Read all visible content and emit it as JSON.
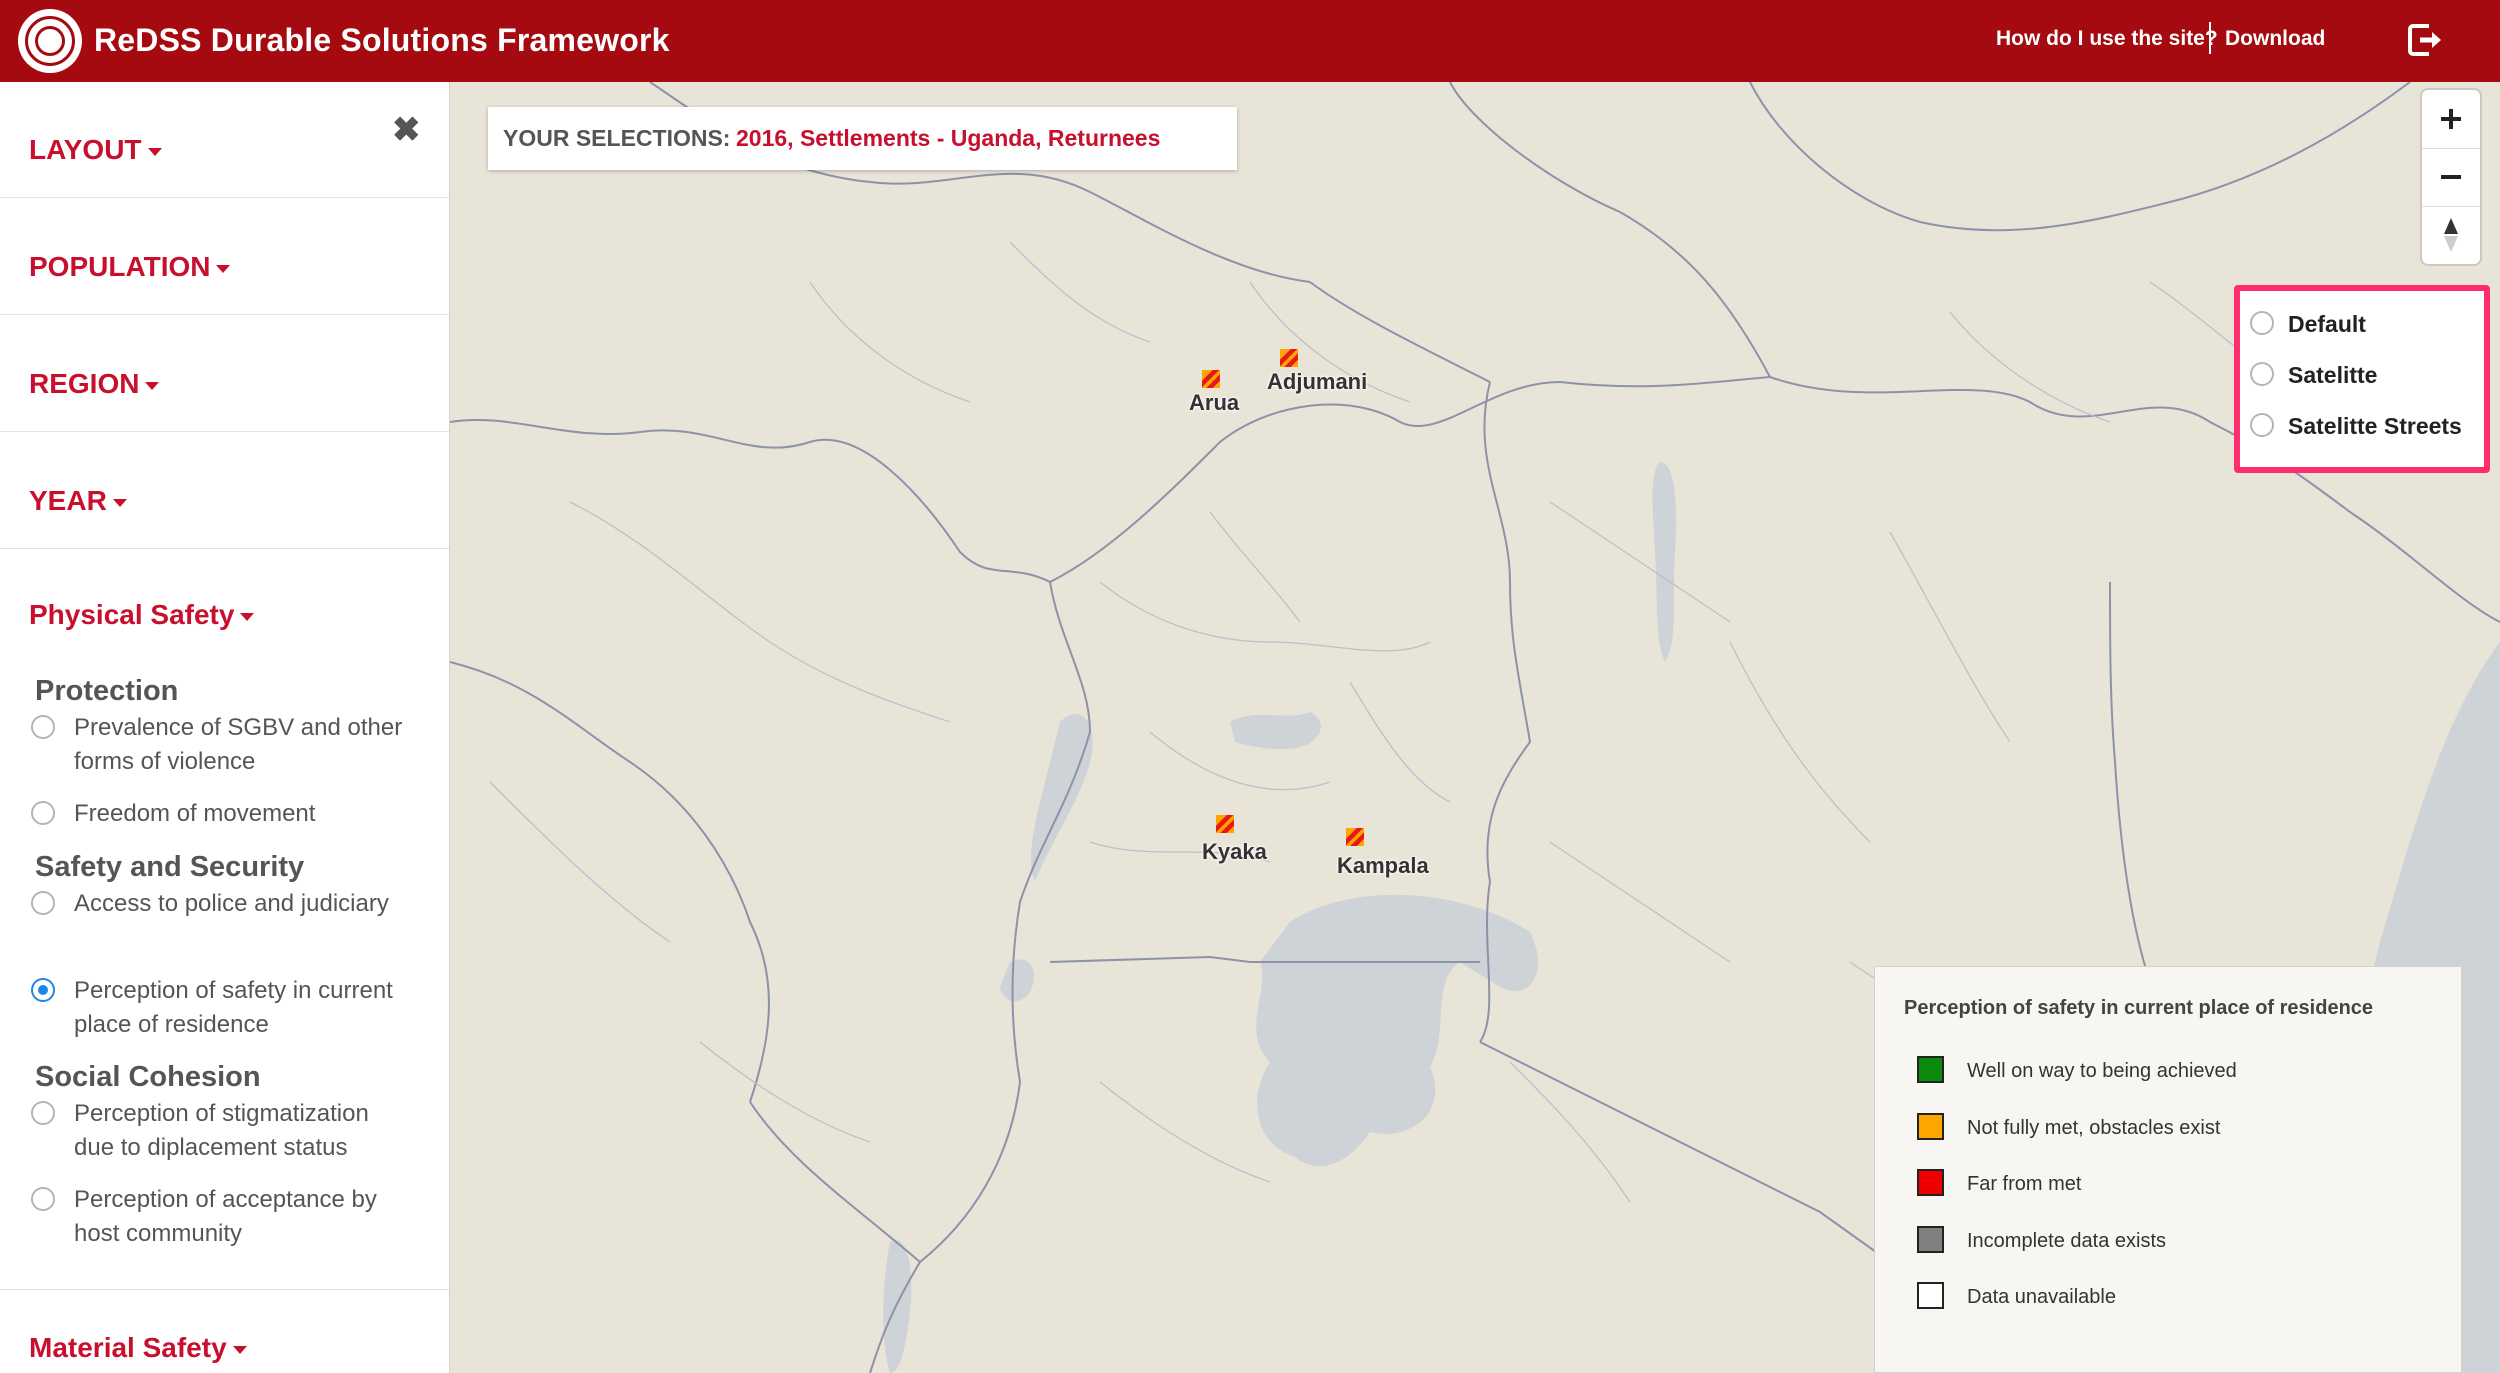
{
  "header": {
    "title": "ReDSS Durable Solutions Framework",
    "help_link": "How do I use the site?",
    "download_link": "Download"
  },
  "sidebar": {
    "sections": [
      "LAYOUT",
      "POPULATION",
      "REGION",
      "YEAR"
    ],
    "active_section": "Physical Safety",
    "groups": [
      {
        "title": "Protection",
        "options": [
          "Prevalence of SGBV and other forms of violence",
          "Freedom of movement"
        ]
      },
      {
        "title": "Safety and Security",
        "options": [
          "Access to police and judiciary",
          "Perception of safety in current place of residence"
        ]
      },
      {
        "title": "Social Cohesion",
        "options": [
          "Perception of stigmatization due to diplacement status",
          "Perception of acceptance by host community"
        ]
      }
    ],
    "selected_option": "Perception of safety in current place of residence",
    "next_section": "Material Safety"
  },
  "selections": {
    "label": "YOUR SELECTIONS:",
    "value": "2016, Settlements - Uganda, Returnees"
  },
  "map_style": {
    "options": [
      "Default",
      "Satelitte",
      "Satelitte Streets"
    ]
  },
  "markers": [
    {
      "name": "Adjumani",
      "status": "Far from met"
    },
    {
      "name": "Arua",
      "status": "Far from met"
    },
    {
      "name": "Kyaka",
      "status": "Far from met"
    },
    {
      "name": "Kampala",
      "status": "Far from met"
    }
  ],
  "legend": {
    "title": "Perception of safety in current place of residence",
    "items": [
      {
        "label": "Well on way to being achieved",
        "color": "#0b8a0b"
      },
      {
        "label": "Not fully met, obstacles exist",
        "color": "#ffa500"
      },
      {
        "label": "Far from met",
        "color": "#ee0000"
      },
      {
        "label": "Incomplete data exists",
        "color": "#808080"
      },
      {
        "label": "Data unavailable",
        "color": "#ffffff"
      }
    ]
  },
  "colors": {
    "brand": "#a40a10",
    "accent_text": "#c8102e",
    "radio_selected": "#1e88e5",
    "highlight_border": "#ff2d6b",
    "water": "#cdd3d6",
    "land": "#e9e4d8"
  },
  "icons": [
    "logo-icon",
    "logout-icon",
    "close-icon",
    "zoom-in-icon",
    "zoom-out-icon",
    "compass-icon",
    "caret-down-icon"
  ]
}
